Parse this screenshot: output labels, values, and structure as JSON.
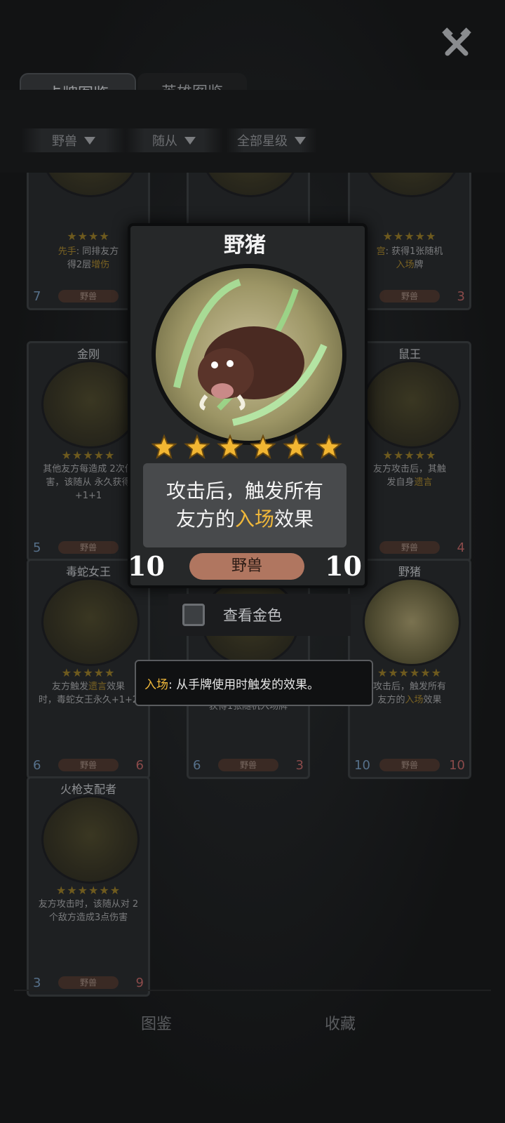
{
  "tabs": {
    "active": "卡牌图鉴",
    "inactive": "英雄图鉴"
  },
  "filters": [
    {
      "label": "野兽"
    },
    {
      "label": "随从"
    },
    {
      "label": "全部星级"
    }
  ],
  "bg_cards": [
    {
      "name": "",
      "stars": "★★★★",
      "desc_pre": "先手",
      "desc_mid": ": 同排友方",
      "desc2_pre": "得2层",
      "desc2_hl": "增伤",
      "cost": "7",
      "atk": "",
      "tribe": "野兽"
    },
    {
      "name": "",
      "stars": "★★★★★",
      "desc_pre": "",
      "desc_mid": "",
      "desc2_pre": "",
      "desc2_hl": "",
      "cost": "",
      "atk": "",
      "tribe": ""
    },
    {
      "name": "",
      "stars": "★★★★★",
      "desc_pre": "宫",
      "desc_mid": ": 获得1张随机",
      "desc2_pre": "",
      "desc2_hl": "入场",
      "desc2_post": "牌",
      "cost": "",
      "atk": "3",
      "tribe": "野兽"
    },
    {
      "name": "金刚",
      "stars": "★★★★★",
      "desc": "其他友方每造成 2次伤害，该随从 永久获得+1+1",
      "cost": "5",
      "atk": "",
      "tribe": "野兽"
    },
    {
      "name": "鼠王",
      "stars": "★★★★★",
      "desc_pre": "友方攻击后，其触",
      "desc2_pre": "发自身",
      "desc2_hl": "遗言",
      "cost": "",
      "atk": "4",
      "tribe": "野兽"
    },
    {
      "name": "毒蛇女王",
      "stars": "★★★★★",
      "desc_pre": "友方触发",
      "desc_hl": "遗言",
      "desc_mid": "效果",
      "desc2_pre": "时，毒蛇女王永久+1+2",
      "cost": "6",
      "atk": "6",
      "tribe": "野兽"
    },
    {
      "name": "",
      "stars": "",
      "desc": "获得1张随机入场牌",
      "cost": "6",
      "atk": "3",
      "tribe": "野兽"
    },
    {
      "name": "野猪",
      "stars": "★★★★★★",
      "desc_pre": "攻击后，触发所有",
      "desc2_pre": "友方的",
      "desc2_hl": "入场",
      "desc2_post": "效果",
      "cost": "10",
      "atk": "10",
      "tribe": "野兽"
    },
    {
      "name": "火枪支配者",
      "stars": "★★★★★★",
      "desc": "友方攻击时，该随从对 2个敌方造成3点伤害",
      "cost": "3",
      "atk": "9",
      "tribe": "野兽"
    }
  ],
  "featured": {
    "name": "野猪",
    "star_count": 6,
    "desc_line1": "攻击后，触发所有",
    "desc_line2_pre": "友方的",
    "desc_line2_hl": "入场",
    "desc_line2_post": "效果",
    "cost": "10",
    "attack": "10",
    "tribe": "野兽"
  },
  "gold_toggle": {
    "label": "查看金色",
    "checked": false
  },
  "tooltip": {
    "keyword": "入场",
    "text": ": 从手牌使用时触发的效果。"
  },
  "bottom_nav": {
    "left": "图鉴",
    "right": "收藏"
  },
  "colors": {
    "highlight": "#f0b83a",
    "tribe_pill": "#b07660",
    "background": "#141516"
  }
}
